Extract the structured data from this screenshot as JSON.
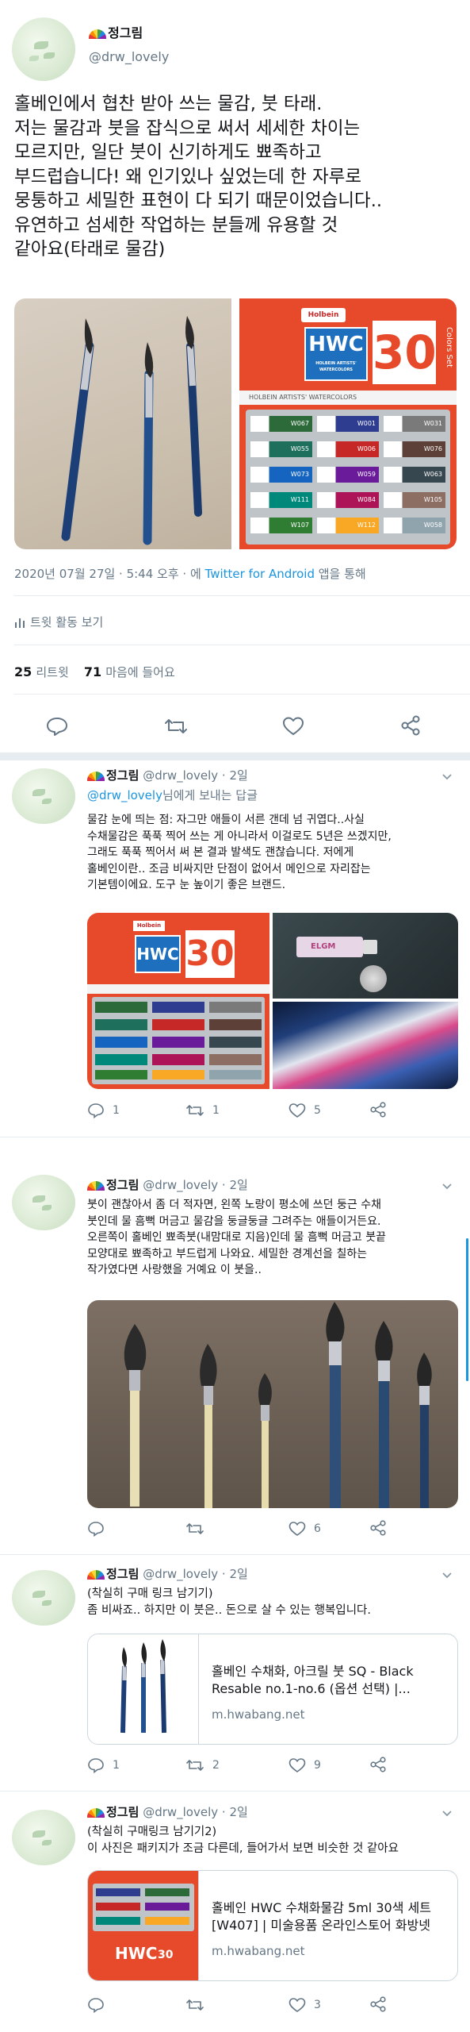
{
  "main_tweet": {
    "author_name": "정그림",
    "author_handle": "@drw_lovely",
    "text_lines": [
      "홀베인에서 협찬 받아 쓰는 물감, 붓 타래.",
      "저는 물감과 붓을 잡식으로 써서 세세한 차이는",
      "모르지만, 일단 붓이 신기하게도 뾰족하고",
      "부드럽습니다! 왜 인기있나 싶었는데 한 자루로",
      "뭉퉁하고 세밀한 표현이 다 되기 때문이었습니다..",
      "유연하고 섬세한 작업하는 분들께 유용할 것",
      "같아요(타래로 물감)"
    ],
    "timestamp": "2020년 07월 27일 · 5:44 오후 · 에",
    "via_link": "Twitter for Android",
    "via_suffix": "앱을 통해",
    "activity_label": "트윗 활동 보기",
    "retweet_count": "25",
    "retweet_label": "리트윗",
    "like_count": "71",
    "like_label": "마음에 들어요"
  },
  "hwc_box": {
    "brand": "Holbein",
    "title": "HWC",
    "subtitle": "HOLBEIN ARTISTS' WATERCOLORS",
    "count": "30",
    "side": "Colors Set",
    "strip": "HOLBEIN ARTISTS' WATERCOLORS",
    "labels": [
      "W067",
      "W001",
      "W031",
      "W055",
      "W006",
      "W076",
      "W073",
      "W059",
      "W063",
      "W111",
      "W084",
      "W105",
      "W107",
      "W112",
      "W058"
    ]
  },
  "tube": {
    "label": "ELGM"
  },
  "replies": [
    {
      "author_name": "정그림",
      "author_handle": "@drw_lovely",
      "time": "2일",
      "reply_to_handle": "@drw_lovely",
      "reply_to_suffix": "님에게 보내는 답글",
      "text_lines": [
        "물감 눈에 띄는 점: 자그만 애들이 서른 갠데 넘 귀엽다..사실",
        "수채물감은 푹푹 찍어 쓰는 게 아니라서 이걸로도 5년은 쓰겠지만,",
        "그래도 푹푹 찍어서 써 본 결과 발색도 괜찮습니다. 저에게",
        "홀베인이란.. 조금 비싸지만 단점이 없어서 메인으로 자리잡는",
        "기본템이에요. 도구 눈 높이기 좋은 브랜드."
      ],
      "reply_count": "1",
      "retweet_count": "1",
      "like_count": "5"
    },
    {
      "author_name": "정그림",
      "author_handle": "@drw_lovely",
      "time": "2일",
      "text_lines": [
        "붓이 괜찮아서 좀 더 적자면, 왼쪽 노랑이 평소에 쓰던 둥근 수채",
        "붓인데 물 흠뻑 머금고 물감을 둥글둥글 그려주는 애들이거든요.",
        "오른쪽이 홀베인 뾰족붓(내맘대로 지음)인데 물 흠뻑 머금고 붓끝",
        "모양대로 뾰족하고 부드럽게 나와요. 세밀한 경계선을 칠하는",
        "작가였다면 사랑했을 거예요 이 붓을.."
      ],
      "reply_count": "",
      "retweet_count": "",
      "like_count": "6"
    },
    {
      "author_name": "정그림",
      "author_handle": "@drw_lovely",
      "time": "2일",
      "text_lines": [
        "(착실히 구매 링크 남기기)",
        "좀 비싸죠.. 하지만 이 붓은.. 돈으로 살 수 있는 행복입니다."
      ],
      "card_title_lines": [
        "홀베인 수채화, 아크릴 붓 SQ - Black",
        "Resable no.1-no.6 (옵션 선택) |..."
      ],
      "card_url": "m.hwabang.net",
      "reply_count": "1",
      "retweet_count": "2",
      "like_count": "9"
    },
    {
      "author_name": "정그림",
      "author_handle": "@drw_lovely",
      "time": "2일",
      "text_lines": [
        "(착실히 구매링크 남기기2)",
        "이 사진은 패키지가 조금 다른데, 들어가서 보면 비슷한 것 같아요"
      ],
      "card_title_lines": [
        "홀베인 HWC 수채화물감 5ml 30색 세트",
        "[W407] | 미술용품 온라인스토어 화방넷"
      ],
      "card_url": "m.hwabang.net",
      "reply_count": "",
      "retweet_count": "",
      "like_count": "3"
    }
  ]
}
